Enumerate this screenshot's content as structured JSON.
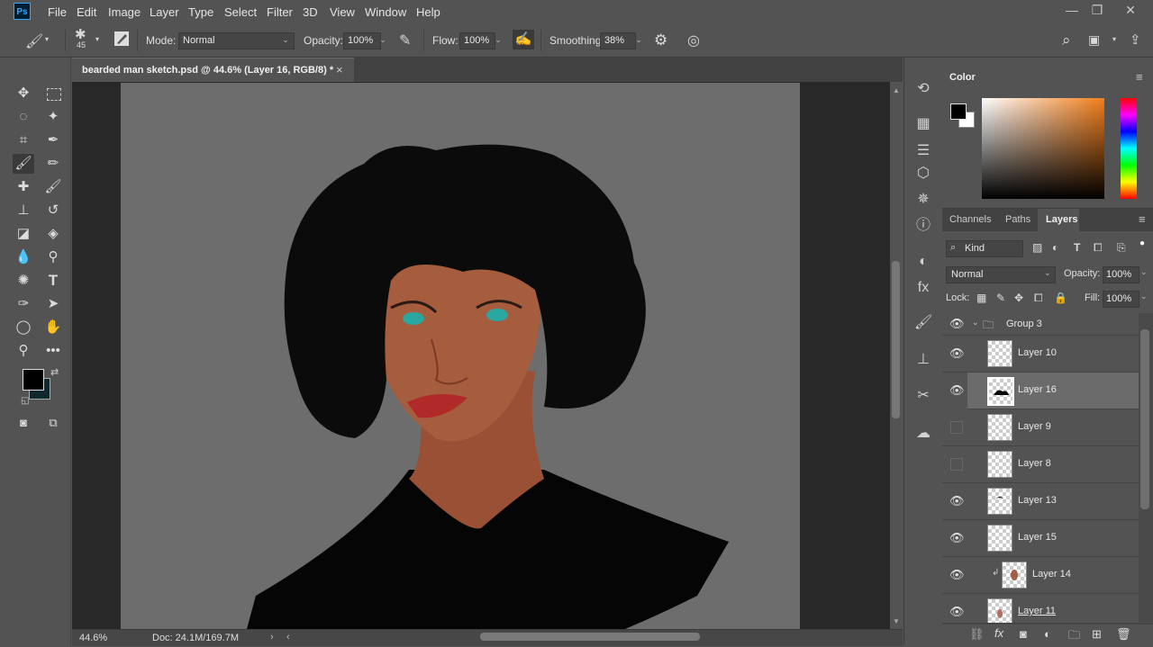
{
  "app": {
    "logo": "Ps"
  },
  "menu": [
    "File",
    "Edit",
    "Image",
    "Layer",
    "Type",
    "Select",
    "Filter",
    "3D",
    "View",
    "Window",
    "Help"
  ],
  "window_controls": {
    "minimize": "—",
    "restore": "❐",
    "close": "✕"
  },
  "options": {
    "brush_size": "45",
    "mode_label": "Mode:",
    "mode_value": "Normal",
    "opacity_label": "Opacity:",
    "opacity_value": "100%",
    "flow_label": "Flow:",
    "flow_value": "100%",
    "smoothing_label": "Smoothing:",
    "smoothing_value": "38%"
  },
  "document": {
    "tab_title": "bearded man sketch.psd @ 44.6% (Layer 16, RGB/8) *",
    "tab_close": "×"
  },
  "status": {
    "zoom": "44.6%",
    "doc_info": "Doc: 24.1M/169.7M"
  },
  "color_panel": {
    "title": "Color",
    "foreground": "#000000",
    "background": "#ffffff"
  },
  "layers_panel": {
    "tabs": [
      "Channels",
      "Paths",
      "Layers"
    ],
    "active_tab": "Layers",
    "filter_kind": "Kind",
    "blend_mode": "Normal",
    "opacity_label": "Opacity:",
    "opacity_value": "100%",
    "lock_label": "Lock:",
    "fill_label": "Fill:",
    "fill_value": "100%",
    "group_name": "Group 3",
    "layers": [
      {
        "name": "Layer 10",
        "visible": true,
        "selected": false
      },
      {
        "name": "Layer 16",
        "visible": true,
        "selected": true
      },
      {
        "name": "Layer 9",
        "visible": false,
        "selected": false
      },
      {
        "name": "Layer 8",
        "visible": false,
        "selected": false
      },
      {
        "name": "Layer 13",
        "visible": true,
        "selected": false
      },
      {
        "name": "Layer 15",
        "visible": true,
        "selected": false
      },
      {
        "name": "Layer 14",
        "visible": true,
        "selected": false,
        "clipped": true
      },
      {
        "name": "Layer 11",
        "visible": true,
        "selected": false
      }
    ]
  },
  "tool_colors": {
    "foreground": "#000000",
    "background": "#0f2a2f"
  }
}
